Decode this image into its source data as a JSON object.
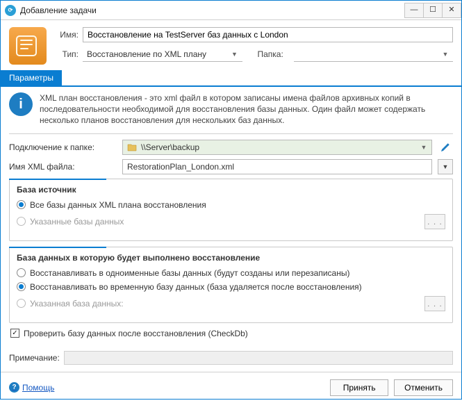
{
  "window": {
    "title": "Добавление задачи",
    "minimize": "—",
    "maximize": "☐",
    "close": "✕"
  },
  "header": {
    "name_label": "Имя:",
    "name_value": "Восстановление на TestServer баз данных с London",
    "type_label": "Тип:",
    "type_value": "Восстановление по XML плану",
    "folder_label": "Папка:",
    "folder_value": ""
  },
  "tabs": {
    "parameters": "Параметры"
  },
  "info": {
    "text": "XML план восстановления - это xml файл в котором записаны имена файлов архивных копий в последовательности необходимой для восстановления базы данных. Один файл может содержать несколько планов восстановления для нескольких баз данных."
  },
  "form": {
    "connection_label": "Подключение к папке:",
    "connection_value": "\\\\Server\\backup",
    "xml_label": "Имя XML файла:",
    "xml_value": "RestorationPlan_London.xml"
  },
  "source_group": {
    "title": "База источник",
    "opt_all": "Все базы данных XML плана восстановления",
    "opt_specified": "Указанные базы данных"
  },
  "target_group": {
    "title": "База данных в которую будет выполнено восстановление",
    "opt_same": "Восстанавливать в одноименные базы данных (будут созданы или перезаписаны)",
    "opt_temp": "Восстанавливать во временную базу данных (база удаляется после восстановления)",
    "opt_spec": "Указанная база данных:"
  },
  "check": {
    "label": "Проверить базу данных после восстановления (CheckDb)"
  },
  "note": {
    "label": "Примечание:"
  },
  "footer": {
    "help": "Помощь",
    "accept": "Принять",
    "cancel": "Отменить"
  }
}
